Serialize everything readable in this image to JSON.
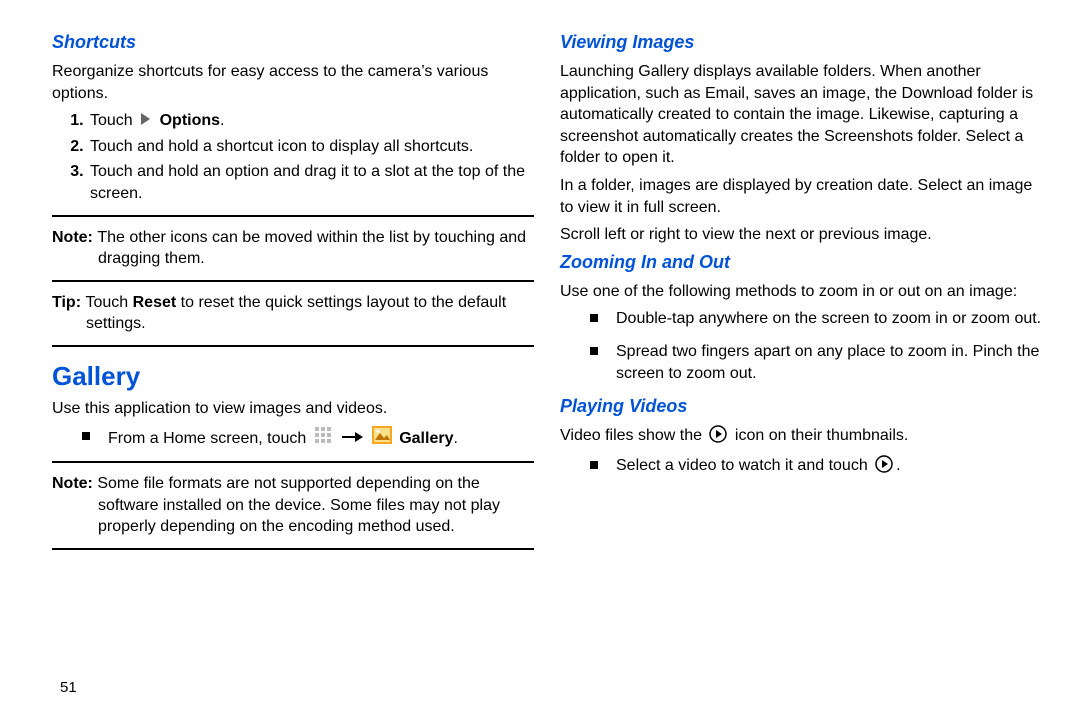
{
  "page_number": "51",
  "left": {
    "h_shortcuts": "Shortcuts",
    "p_shortcuts": "Reorganize shortcuts for easy access to the camera’s various options.",
    "steps": {
      "s1a": "Touch ",
      "s1b": "Options",
      "s1c": ".",
      "s2": "Touch and hold a shortcut icon to display all shortcuts.",
      "s3": "Touch and hold an option and drag it to a slot at the top of the screen."
    },
    "note": {
      "label": "Note: ",
      "text": "The other icons can be moved within the list by touching and dragging them."
    },
    "tip": {
      "label": "Tip: ",
      "a": "Touch ",
      "b": "Reset",
      "c": " to reset the quick settings layout to the default settings."
    },
    "h_gallery": "Gallery",
    "p_gallery": "Use this application to view images and videos.",
    "bullet_gallery": {
      "a": "From a Home screen, touch ",
      "b": "Gallery",
      "c": "."
    },
    "note2": {
      "label": "Note: ",
      "text": "Some file formats are not supported depending on the software installed on the device. Some files may not play properly depending on the encoding method used."
    }
  },
  "right": {
    "h_view": "Viewing Images",
    "p_view1": "Launching Gallery displays available folders. When another application, such as Email, saves an image, the Download folder is automatically created to contain the image. Likewise, capturing a screenshot automatically creates the Screenshots folder. Select a folder to open it.",
    "p_view2": "In a folder, images are displayed by creation date. Select an image to view it in full screen.",
    "p_view3": "Scroll left or right to view the next or previous image.",
    "h_zoom": "Zooming In and Out",
    "p_zoom": "Use one of the following methods to zoom in or out on an image:",
    "zoom_items": {
      "z1": "Double-tap anywhere on the screen to zoom in or zoom out.",
      "z2": "Spread two fingers apart on any place to zoom in. Pinch the screen to zoom out."
    },
    "h_play": "Playing Videos",
    "p_play_a": "Video files show the ",
    "p_play_b": " icon on their thumbnails.",
    "play_item_a": "Select a video to watch it and touch ",
    "play_item_b": "."
  }
}
